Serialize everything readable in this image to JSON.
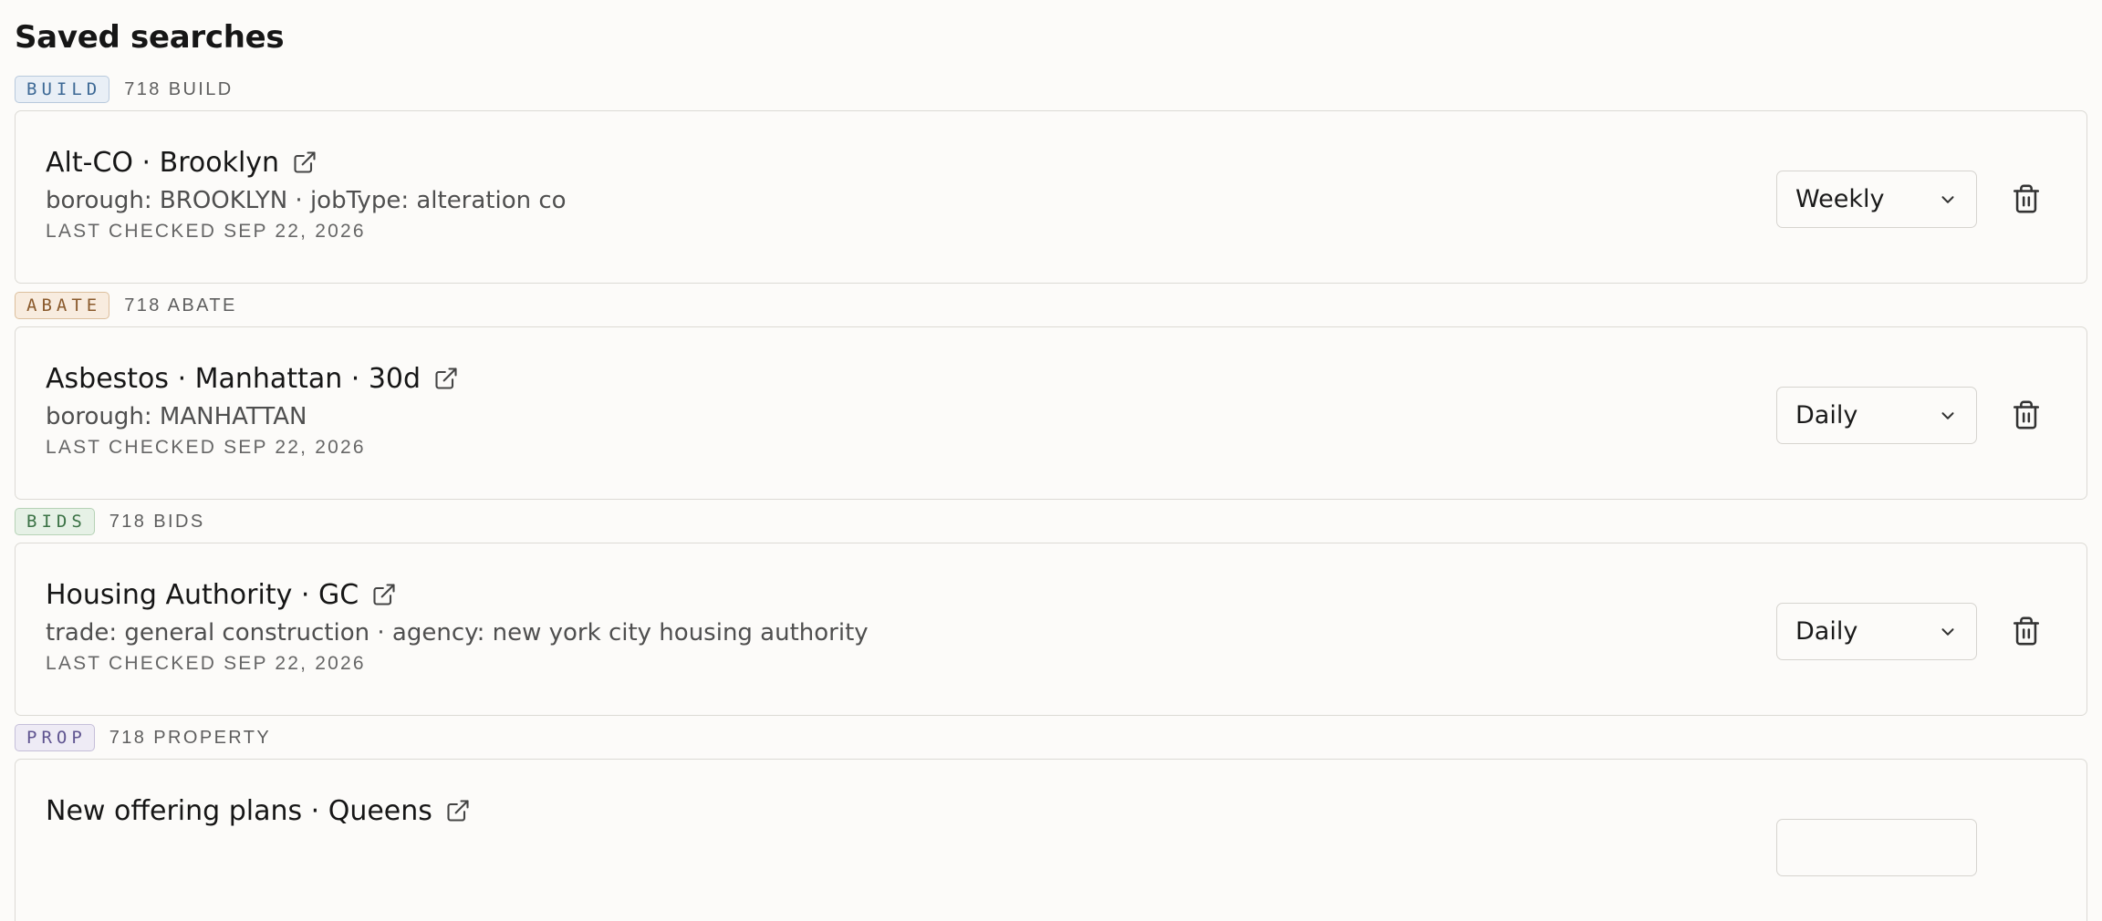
{
  "page": {
    "title": "Saved searches"
  },
  "groups": [
    {
      "tag": "BUILD",
      "count_label": "718 BUILD",
      "search": {
        "title": "Alt-CO · Brooklyn",
        "criteria": "borough: BROOKLYN · jobType: alteration co",
        "last_checked": "LAST CHECKED SEP 22, 2026",
        "frequency": "Weekly"
      }
    },
    {
      "tag": "ABATE",
      "count_label": "718 ABATE",
      "search": {
        "title": "Asbestos · Manhattan · 30d",
        "criteria": "borough: MANHATTAN",
        "last_checked": "LAST CHECKED SEP 22, 2026",
        "frequency": "Daily"
      }
    },
    {
      "tag": "BIDS",
      "count_label": "718 BIDS",
      "search": {
        "title": "Housing Authority · GC",
        "criteria": "trade: general construction · agency: new york city housing authority",
        "last_checked": "LAST CHECKED SEP 22, 2026",
        "frequency": "Daily"
      }
    },
    {
      "tag": "PROP",
      "count_label": "718 PROPERTY",
      "search": {
        "title": "New offering plans · Queens"
      }
    }
  ],
  "icons": {
    "external": "external-link-icon",
    "delete": "trash-icon",
    "dropdown": "chevron-down-icon"
  },
  "colors": {
    "background": "#fcfbf9",
    "card_border": "#dcdad5",
    "build": "#3e6a96",
    "abate": "#8a5a2c",
    "bids": "#3b7245",
    "prop": "#5f5490"
  }
}
